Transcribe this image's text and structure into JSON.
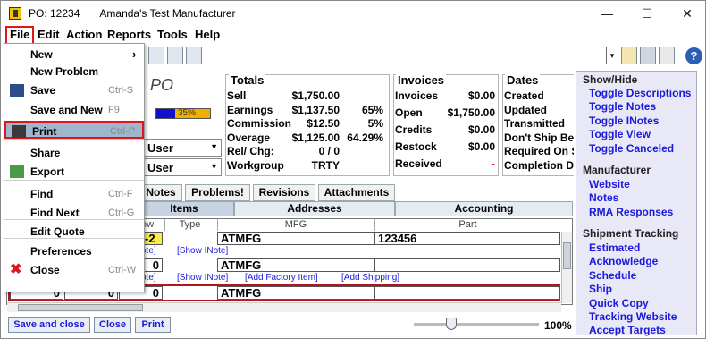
{
  "window": {
    "title_po": "PO: 12234",
    "title_company": "Amanda's Test Manufacturer",
    "controls": [
      "—",
      "☐",
      "✕"
    ]
  },
  "menubar": [
    "File",
    "Edit",
    "Action",
    "Reports",
    "Tools",
    "Help"
  ],
  "file_menu": [
    {
      "label": "New",
      "shortcut": "",
      "arrow": "›"
    },
    {
      "label": "New Problem",
      "shortcut": ""
    },
    {
      "label": "Save",
      "shortcut": "Ctrl-S"
    },
    {
      "label": "Save and New",
      "shortcut": "F9"
    },
    {
      "label": "Print",
      "shortcut": "Ctrl-P"
    },
    {
      "label": "Share",
      "shortcut": ""
    },
    {
      "label": "Export",
      "shortcut": ""
    },
    {
      "label": "Find",
      "shortcut": "Ctrl-F"
    },
    {
      "label": "Find Next",
      "shortcut": "Ctrl-G"
    },
    {
      "label": "Edit Quote",
      "shortcut": ""
    },
    {
      "label": "Preferences",
      "shortcut": ""
    },
    {
      "label": "Close",
      "shortcut": "Ctrl-W"
    }
  ],
  "header": {
    "po_label": "PO",
    "progress_text": "35%",
    "progress_fraction": 0.35,
    "user1": "User",
    "user2": "User"
  },
  "totals": {
    "title": "Totals",
    "rows": [
      {
        "label": "Sell",
        "value": "$1,750.00",
        "pct": ""
      },
      {
        "label": "Earnings",
        "value": "$1,137.50",
        "pct": "65%"
      },
      {
        "label": "Commission",
        "value": "$12.50",
        "pct": "5%"
      },
      {
        "label": "Overage",
        "value": "$1,125.00",
        "pct": "64.29%"
      },
      {
        "label": "Rel/ Chg:",
        "value": "0 / 0",
        "pct": ""
      },
      {
        "label": "Workgroup",
        "value": "TRTY",
        "pct": ""
      }
    ]
  },
  "invoices": {
    "title": "Invoices",
    "rows": [
      {
        "label": "Invoices",
        "value": "$0.00"
      },
      {
        "label": "Open",
        "value": "$1,750.00"
      },
      {
        "label": "Credits",
        "value": "$0.00"
      },
      {
        "label": "Restock",
        "value": "$0.00"
      },
      {
        "label": "Received",
        "value": "-"
      }
    ]
  },
  "dates": {
    "title": "Dates",
    "rows": [
      "Created",
      "Updated",
      "Transmitted",
      "Don't Ship Befo",
      "Required On S",
      "Completion Da"
    ]
  },
  "tabs_top": [
    "Notes",
    "Problems!",
    "Revisions",
    "Attachments"
  ],
  "tabs_sub": [
    "Items",
    "Addresses",
    "Accounting"
  ],
  "grid": {
    "headers": [
      "ow",
      "Type",
      "MFG",
      "Part"
    ],
    "rows": [
      {
        "num": "-2",
        "mfg": "ATMFG",
        "part": "123456"
      },
      {
        "num": "0",
        "mfg": "ATMFG",
        "part": ""
      },
      {
        "num": "0",
        "mfg": "ATMFG",
        "part": "",
        "pre": [
          "0",
          "0"
        ]
      }
    ],
    "link_note": "ote]",
    "link_show": "[Show INote]",
    "link_factory": "[Add Factory Item]",
    "link_shipping": "[Add Shipping]"
  },
  "bottom": {
    "save_close": "Save and close",
    "close": "Close",
    "print": "Print",
    "zoom": "100%",
    "zoom_fraction": 0.3
  },
  "panel": {
    "show_hide_title": "Show/Hide",
    "show_hide": [
      "Toggle Descriptions",
      "Toggle Notes",
      "Toggle INotes",
      "Toggle View",
      "Toggle Canceled"
    ],
    "manufacturer_title": "Manufacturer",
    "manufacturer": [
      "Website",
      "Notes",
      "RMA Responses"
    ],
    "shipment_title": "Shipment Tracking",
    "shipment": [
      "Estimated",
      "Acknowledge",
      "Schedule",
      "Ship",
      "Quick Copy",
      "Tracking Website",
      "Accept Targets"
    ]
  },
  "colors": {
    "highlight_red": "#e0161d",
    "link_blue": "#1a1adb",
    "panel_bg": "#e8e8f7",
    "progress_blue": "#1010d0",
    "progress_orange": "#f0b000"
  }
}
